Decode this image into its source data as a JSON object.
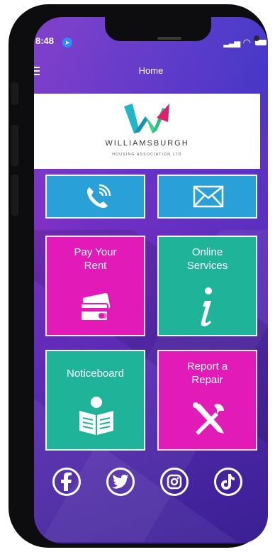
{
  "status": {
    "time": "8:48"
  },
  "header": {
    "title": "Home"
  },
  "logo": {
    "name": "WILLIAMSBURGH",
    "subtitle": "HOUSING ASSOCIATION LTD"
  },
  "tiles": [
    {
      "label": "",
      "icon": "phone-icon",
      "color": "#2aa0d8"
    },
    {
      "label": "",
      "icon": "envelope-icon",
      "color": "#2aa0d8"
    },
    {
      "label": "Pay Your Rent",
      "icon": "card-icon",
      "color": "#e11ab8"
    },
    {
      "label": "Online Services",
      "icon": "info-icon",
      "color": "#1fb39a"
    },
    {
      "label": "Noticeboard",
      "icon": "newspaper-icon",
      "color": "#1fb39a"
    },
    {
      "label": "Report a Repair",
      "icon": "tools-icon",
      "color": "#e11ab8"
    }
  ],
  "social": [
    {
      "icon": "facebook-icon"
    },
    {
      "icon": "twitter-icon"
    },
    {
      "icon": "instagram-icon"
    },
    {
      "icon": "tiktok-icon"
    }
  ],
  "colors": {
    "background": "#5d3fd0",
    "blue": "#2aa0d8",
    "pink": "#e11ab8",
    "green": "#1fb39a",
    "logo_teal": "#1fb7c8",
    "logo_green": "#3fcf8e",
    "logo_pink": "#e0206f"
  }
}
